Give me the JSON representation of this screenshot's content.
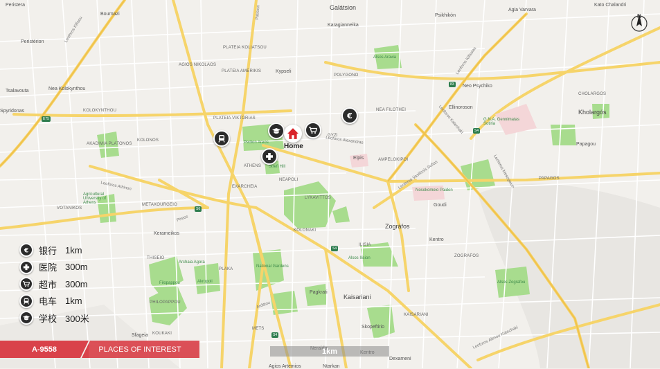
{
  "map": {
    "place_labels": [
      {
        "text": "Peristera"
      },
      {
        "text": "Bournazi"
      },
      {
        "text": "Galátsion"
      },
      {
        "text": "Psikhikón"
      },
      {
        "text": "Agia Varvara"
      },
      {
        "text": "Kato Chalandri"
      },
      {
        "text": "Peristérion"
      },
      {
        "text": "Karagianneika"
      },
      {
        "text": "Kypseli"
      },
      {
        "text": "POLYGONO"
      },
      {
        "text": "Neo Psychiko"
      },
      {
        "text": "Nea Kolokynthou"
      },
      {
        "text": "Tsalavouta"
      },
      {
        "text": "Spyridonas"
      },
      {
        "text": "KOLOKYNTHOU"
      },
      {
        "text": "CHOLARGOS"
      },
      {
        "text": "Kholargós"
      },
      {
        "text": "NEA FILOTHEI"
      },
      {
        "text": "Ellinoroson"
      },
      {
        "text": "AKADIMIA PLATONOS"
      },
      {
        "text": "KOLONOS"
      },
      {
        "text": "PLATEIA VIKTORIAS"
      },
      {
        "text": "AGIOS NIKOLAOS"
      },
      {
        "text": "PLATEIA KOLIATSOU"
      },
      {
        "text": "PLATEIA AMERIKIS"
      },
      {
        "text": "Pedion Areos"
      },
      {
        "text": "GYZI"
      },
      {
        "text": "Papagou"
      },
      {
        "text": "ATHENS"
      },
      {
        "text": "Strefi Hill"
      },
      {
        "text": "AMPELOKIPOI"
      },
      {
        "text": "Elpis"
      },
      {
        "text": "EXARCHEIA"
      },
      {
        "text": "NEAPOLI"
      },
      {
        "text": "PAPAGOS"
      },
      {
        "text": "VOTANIKOS"
      },
      {
        "text": "METAXOURGEIO"
      },
      {
        "text": "LYKAVITTOS"
      },
      {
        "text": "Goudi"
      },
      {
        "text": "Agricultural University of Athens"
      },
      {
        "text": "Kerameikos"
      },
      {
        "text": "KOLONAKI"
      },
      {
        "text": "Zográfos"
      },
      {
        "text": "Kentro"
      },
      {
        "text": "THISEIO"
      },
      {
        "text": "PLAKA"
      },
      {
        "text": "ILISIA"
      },
      {
        "text": "ZOGRAFOS"
      },
      {
        "text": "Archaia Agora"
      },
      {
        "text": "Akropoli"
      },
      {
        "text": "National Gardens"
      },
      {
        "text": "Alsos Ilision"
      },
      {
        "text": "Filopappou"
      },
      {
        "text": "PHILOPAPPOU"
      },
      {
        "text": "Pagkrati"
      },
      {
        "text": "Kaisariani"
      },
      {
        "text": "KAISARIANI"
      },
      {
        "text": "Sfageia"
      },
      {
        "text": "KOUKAKI"
      },
      {
        "text": "METS"
      },
      {
        "text": "Skopeftirio"
      },
      {
        "text": "Neraida"
      },
      {
        "text": "Kentro"
      },
      {
        "text": "Dexameni"
      },
      {
        "text": "Agios Artemios"
      },
      {
        "text": "Ntarkan"
      },
      {
        "text": "AGIOS KOSMAS"
      },
      {
        "text": "G.N.A. Gennimatas Sotiria"
      },
      {
        "text": "Nosokomeio Paidon"
      },
      {
        "text": "Alsos Zografou"
      },
      {
        "text": "Alsos Aravia"
      }
    ],
    "road_labels": [
      {
        "text": "Leoforos Kifisou"
      },
      {
        "text": "Leoforos Athinon"
      },
      {
        "text": "Leoforos Kifissias"
      },
      {
        "text": "Patision"
      },
      {
        "text": "Leoforos Vasilissis Sofias"
      },
      {
        "text": "Leoforos Alexandras"
      },
      {
        "text": "Leoforos Mesogeion"
      },
      {
        "text": "Leoforos Katechaki"
      },
      {
        "text": "Pireos"
      },
      {
        "text": "Ardittou"
      },
      {
        "text": "Leoforos Alimou Katechaki"
      }
    ],
    "route_shields": [
      "E75",
      "83",
      "S4",
      "S6",
      "S4",
      "S4"
    ]
  },
  "home": {
    "label": "Home"
  },
  "legend": [
    {
      "icon": "bank-icon",
      "name": "银行",
      "distance": "1km"
    },
    {
      "icon": "hospital-icon",
      "name": "医院",
      "distance": "300m"
    },
    {
      "icon": "supermarket-icon",
      "name": "超市",
      "distance": "300m"
    },
    {
      "icon": "tram-icon",
      "name": "电车",
      "distance": "1km"
    },
    {
      "icon": "school-icon",
      "name": "学校",
      "distance": "300米"
    }
  ],
  "footer": {
    "code": "A-9558",
    "title": "PLACES OF INTEREST"
  },
  "scale": {
    "label": "1km"
  },
  "compass": {
    "label": "N"
  },
  "colors": {
    "accent": "#d9424a",
    "park": "#a8dc8e",
    "major_road": "#f6d46a",
    "background": "#f2f0ec",
    "poi": "#2b2b2b"
  }
}
